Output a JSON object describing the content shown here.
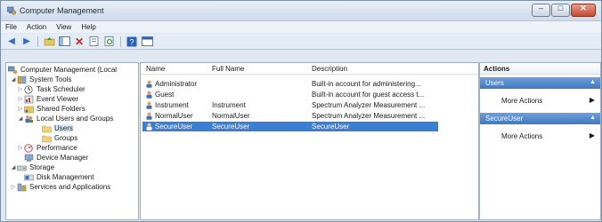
{
  "window": {
    "title": "Computer Management",
    "controls": {
      "minimize": "–",
      "maximize": "□",
      "close": "✕"
    }
  },
  "menubar": {
    "items": [
      "File",
      "Action",
      "View",
      "Help"
    ]
  },
  "toolbar": {
    "icons": [
      "back-icon",
      "forward-icon",
      "up-folder-icon",
      "show-hide-tree-icon",
      "delete-icon",
      "properties-icon",
      "refresh-icon",
      "help-icon",
      "view-icon"
    ]
  },
  "tree": {
    "items": [
      {
        "label": "Computer Management (Local",
        "level": 0,
        "arrow": ""
      },
      {
        "label": "System Tools",
        "level": 1,
        "arrow": "◢"
      },
      {
        "label": "Task Scheduler",
        "level": 2,
        "arrow": "▷"
      },
      {
        "label": "Event Viewer",
        "level": 2,
        "arrow": "▷"
      },
      {
        "label": "Shared Folders",
        "level": 2,
        "arrow": "▷"
      },
      {
        "label": "Local Users and Groups",
        "level": 2,
        "arrow": "◢"
      },
      {
        "label": "Users",
        "level": 3,
        "arrow": ""
      },
      {
        "label": "Groups",
        "level": 3,
        "arrow": ""
      },
      {
        "label": "Performance",
        "level": 2,
        "arrow": "▷"
      },
      {
        "label": "Device Manager",
        "level": 2,
        "arrow": ""
      },
      {
        "label": "Storage",
        "level": 1,
        "arrow": "◢"
      },
      {
        "label": "Disk Management",
        "level": 2,
        "arrow": ""
      },
      {
        "label": "Services and Applications",
        "level": 1,
        "arrow": "▷"
      }
    ]
  },
  "list": {
    "columns": [
      "Name",
      "Full Name",
      "Description"
    ],
    "rows": [
      {
        "name": "Administrator",
        "full_name": "",
        "description": "Built-in account for administering..."
      },
      {
        "name": "Guest",
        "full_name": "",
        "description": "Built-in account for guest access t..."
      },
      {
        "name": "Instrument",
        "full_name": "Instrument",
        "description": "Spectrum Analyzer Measurement ..."
      },
      {
        "name": "NormalUser",
        "full_name": "NormalUser",
        "description": "Spectrum Analyzer Measurement ..."
      },
      {
        "name": "SecureUser",
        "full_name": "SecureUser",
        "description": "SecureUser",
        "selected": true
      }
    ]
  },
  "actions": {
    "title": "Actions",
    "groups": [
      {
        "label": "Users",
        "item": "More Actions"
      },
      {
        "label": "SecureUser",
        "item": "More Actions"
      }
    ]
  },
  "colors": {
    "selection": "#3b7fd4",
    "action_group": "#3f79c2",
    "window_frame": "#dfe8f3"
  }
}
